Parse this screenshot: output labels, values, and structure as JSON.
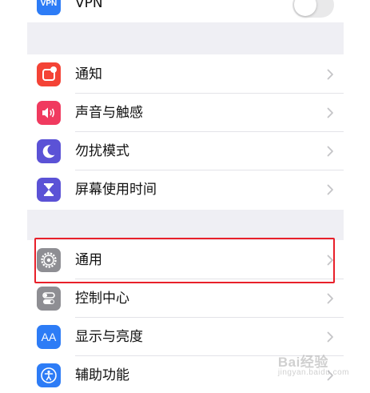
{
  "colors": {
    "accent_highlight": "#e8202a",
    "group_background": "#efeff4",
    "chevron": "#c4c4c7",
    "toggle_off": "#e9e9ea"
  },
  "vpn": {
    "icon_text": "VPN",
    "label": "VPN",
    "icon_color": "#2d7cf6",
    "toggle_state": "off"
  },
  "group1": [
    {
      "label": "通知",
      "icon": "notifications-icon",
      "icon_color": "#f44336"
    },
    {
      "label": "声音与触感",
      "icon": "speaker-icon",
      "icon_color": "#f03a5f"
    },
    {
      "label": "勿扰模式",
      "icon": "moon-icon",
      "icon_color": "#5b52d6"
    },
    {
      "label": "屏幕使用时间",
      "icon": "hourglass-icon",
      "icon_color": "#5b52d6"
    }
  ],
  "group2": [
    {
      "label": "通用",
      "icon": "gear-icon",
      "icon_color": "#8e8e93",
      "highlighted": true
    },
    {
      "label": "控制中心",
      "icon": "toggles-icon",
      "icon_color": "#8e8e93"
    },
    {
      "label": "显示与亮度",
      "icon_text": "AA",
      "icon": "text-size-icon",
      "icon_color": "#2d7cf6"
    },
    {
      "label": "辅助功能",
      "icon": "accessibility-icon",
      "icon_color": "#2d7cf6"
    }
  ],
  "watermark": {
    "brand": "Bai",
    "brand_suffix": "经验",
    "subtext": "jingyan.baidu.com"
  }
}
